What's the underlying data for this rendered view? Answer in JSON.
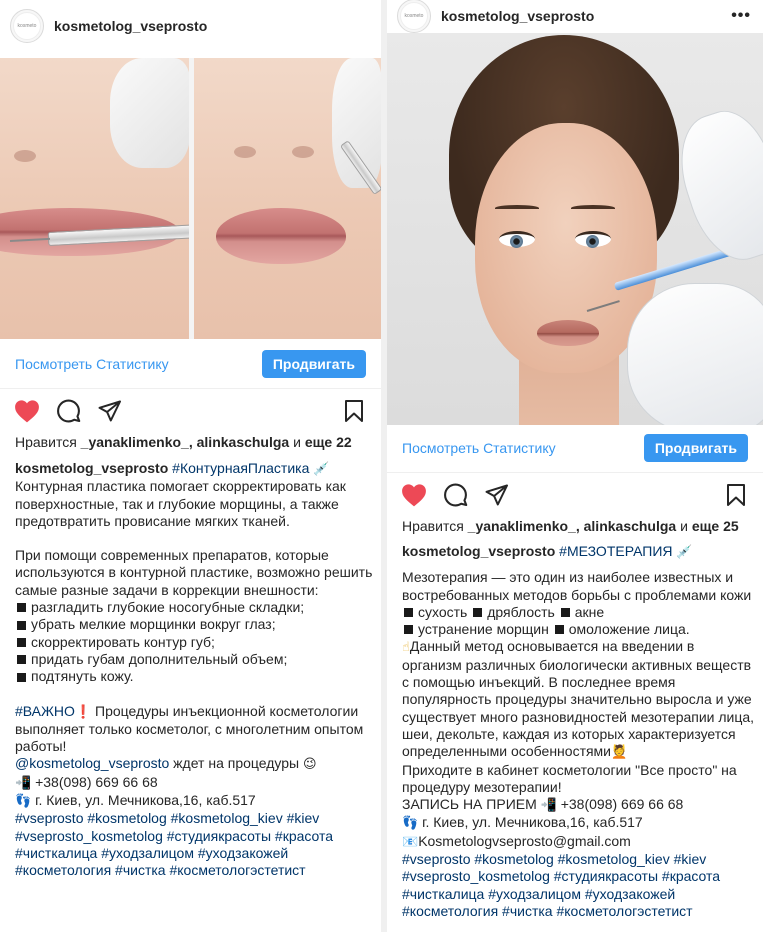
{
  "colors": {
    "accent": "#3897f0",
    "hashtag": "#003569",
    "heart": "#ed4956",
    "text": "#262626"
  },
  "left_post": {
    "username": "kosmetolog_vseprosto",
    "avatar_text": "kosmeto",
    "stats_link": "Посмотреть Статистику",
    "promote_button": "Продвигать",
    "likes_prefix": "Нравится",
    "likes_users": "_yanaklimenko_, alinkaschulga",
    "likes_and": "и",
    "likes_count": "еще 22",
    "caption": {
      "username": "kosmetolog_vseprosto",
      "tag": "#КонтурнаяПластика",
      "tag_emoji": "💉",
      "para1": "Контурная пластика помогает скорректировать как поверхностные, так и глубокие морщины, а также предотвратить провисание мягких тканей.",
      "para2": "При помощи современных препаратов, которые используются в контурной пластике, возможно решить самые разные задачи в коррекции внешности:",
      "bullets": [
        "разгладить глубокие носогубные складки;",
        "убрать мелкие морщинки вокруг глаз;",
        "скорректировать контур губ;",
        "придать губам дополнительный объем;",
        "подтянуть кожу."
      ],
      "important_tag": "#ВАЖНО",
      "important_mark": "❗",
      "important_text": " Процедуры инъекционной косметологии выполняет только косметолог, с многолетним опытом работы!",
      "mention": "@kosmetolog_vseprosto",
      "mention_text": " ждет на процедуры ",
      "mention_emoji": "😉",
      "phone_emoji": "📲",
      "phone": " +38(098) 669 66 68",
      "address_emoji": "👣",
      "address": " г. Киев, ул. Мечникова,16, каб.517",
      "hashtags": "#vseprosto #kosmetolog #kosmetolog_kiev #kiev #vseprosto_kosmetolog #студиякрасоты #красота #чисткалица #уходзалицом #уходзакожей #косметология #чистка #косметологэстетист"
    }
  },
  "right_post": {
    "username": "kosmetolog_vseprosto",
    "avatar_text": "kosmeto",
    "more_icon": "•••",
    "stats_link": "Посмотреть Статистику",
    "promote_button": "Продвигать",
    "likes_prefix": "Нравится",
    "likes_users": "_yanaklimenko_, alinkaschulga",
    "likes_and": "и",
    "likes_count": "еще 25",
    "caption": {
      "username": "kosmetolog_vseprosto",
      "tag": "#МЕЗОТЕРАПИЯ",
      "tag_emoji": "💉",
      "intro": "Мезотерапия —  это один из наиболее известных и востребованных методов борьбы с проблемами кожи ",
      "items_line1": [
        "сухость",
        "дряблость",
        "акне"
      ],
      "items_line2": [
        "устранение морщин",
        "омоложение лица."
      ],
      "pointer_emoji": "☝",
      "body": "Данный метод основывается на введении в организм различных биологически активных веществ с помощью инъекций. В последнее время популярность процедуры значительно выросла и уже существует много разновидностей мезотерапии лица, шеи, декольте, каждая из которых характеризуется определенными особенностями",
      "body_emoji": "💆",
      "invite": "Приходите в кабинет косметологии \"Все просто\" на процедуру мезотерапии!",
      "booking": "ЗАПИСЬ НА ПРИЕМ ",
      "phone_emoji": "📲",
      "phone": " +38(098) 669 66 68",
      "address_emoji": "👣",
      "address": " г. Киев, ул. Мечникова,16, каб.517",
      "mail_emoji": "📧",
      "email": "Kosmetologvseprosto@gmail.com",
      "hashtags": "#vseprosto #kosmetolog #kosmetolog_kiev #kiev #vseprosto_kosmetolog #студиякрасоты #красота #чисткалица #уходзалицом #уходзакожей #косметология #чистка #косметологэстетист"
    }
  }
}
